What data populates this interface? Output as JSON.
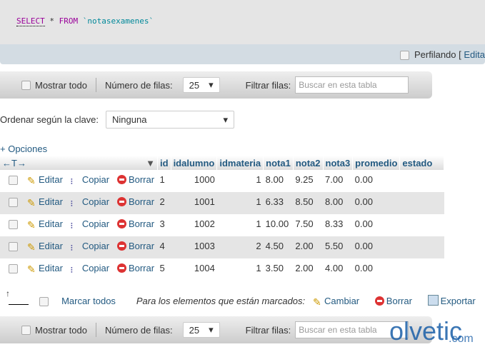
{
  "sql": {
    "select": "SELECT",
    "star": "*",
    "from": "FROM",
    "table": "`notasexamenes`"
  },
  "profiling": {
    "label": "Perfilando [",
    "edit": "Edita"
  },
  "toolbar": {
    "show_all": "Mostrar todo",
    "rows_label": "Número de filas:",
    "rows_value": "25",
    "filter_label": "Filtrar filas:",
    "filter_placeholder": "Buscar en esta tabla"
  },
  "sort": {
    "label": "Ordenar según la clave:",
    "value": "Ninguna"
  },
  "options": "+ Opciones",
  "columns": [
    "id",
    "idalumno",
    "idmateria",
    "nota1",
    "nota2",
    "nota3",
    "promedio",
    "estado"
  ],
  "actions": {
    "edit": "Editar",
    "copy": "Copiar",
    "delete": "Borrar"
  },
  "rows": [
    [
      "1",
      "1000",
      "1",
      "8.00",
      "9.25",
      "7.00",
      "0.00",
      ""
    ],
    [
      "2",
      "1001",
      "1",
      "6.33",
      "8.50",
      "8.00",
      "0.00",
      ""
    ],
    [
      "3",
      "1002",
      "1",
      "10.00",
      "7.50",
      "8.33",
      "0.00",
      ""
    ],
    [
      "4",
      "1003",
      "2",
      "4.50",
      "2.00",
      "5.50",
      "0.00",
      ""
    ],
    [
      "5",
      "1004",
      "1",
      "3.50",
      "2.00",
      "4.00",
      "0.00",
      ""
    ]
  ],
  "bulk": {
    "check_all": "Marcar todos",
    "with_selected": "Para los elementos que están marcados:",
    "change": "Cambiar",
    "delete": "Borrar",
    "export": "Exportar"
  },
  "watermark": {
    "brand": "olvetic",
    "domain": ".com"
  }
}
